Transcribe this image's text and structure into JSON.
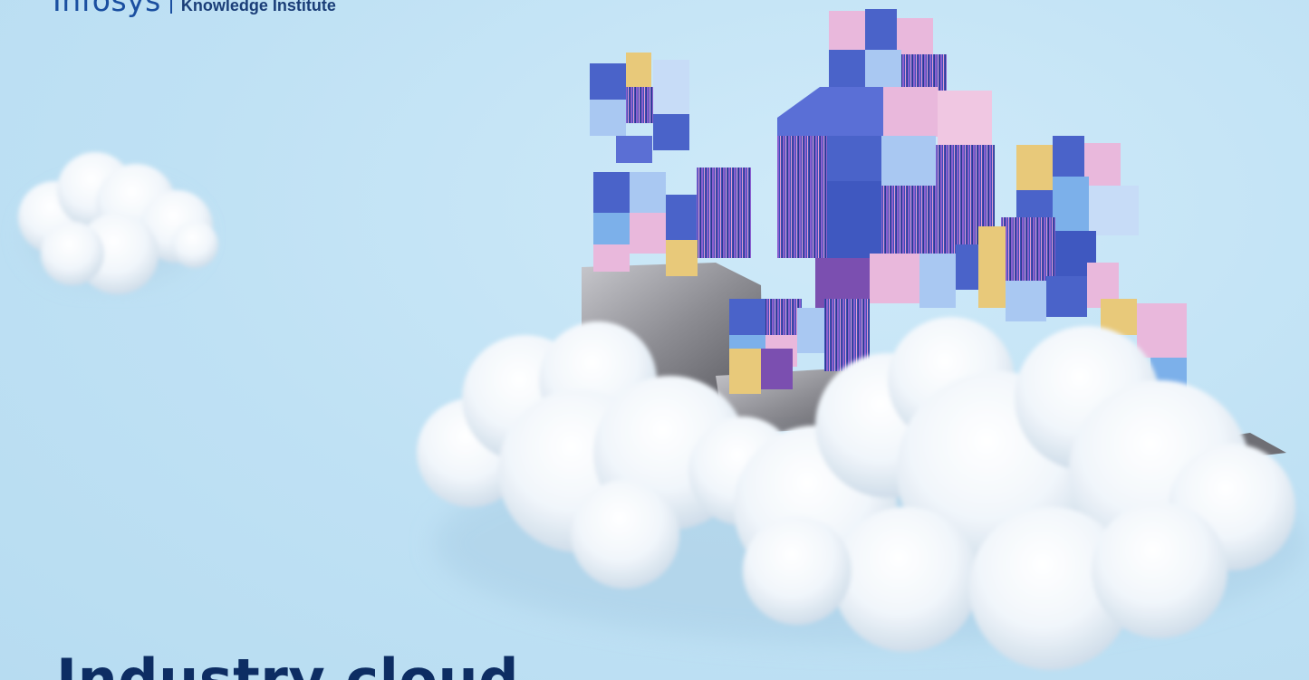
{
  "header": {
    "logo_text": "Infosys",
    "subtitle": "Knowledge Institute"
  },
  "hero": {
    "title": "Industry cloud"
  },
  "palette": {
    "background": "#c0e2f5",
    "brand_blue": "#1a4fa0",
    "title_navy": "#0d2d63",
    "cube_blue": "#4a63c9",
    "cube_light": "#a9c8f2",
    "cube_pink": "#e9b8dc",
    "cube_yellow": "#e8c97a",
    "cube_purple": "#7b4fb0",
    "stone_gray": "#8f8f95"
  }
}
